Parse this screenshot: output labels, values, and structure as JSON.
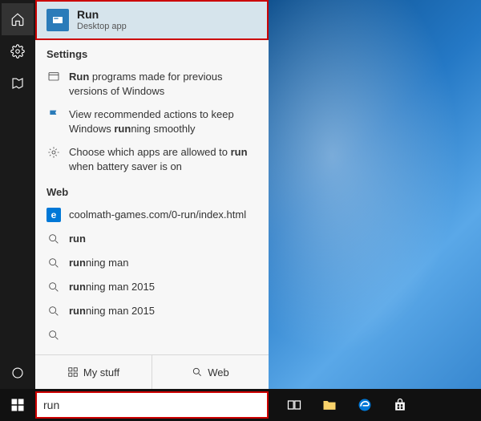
{
  "best_match": {
    "title": "Run",
    "subtitle": "Desktop app"
  },
  "sections": {
    "settings": "Settings",
    "web": "Web"
  },
  "settings_results": [
    {
      "pre": "",
      "bold": "Run",
      "post": " programs made for previous versions of Windows"
    },
    {
      "pre": "View recommended actions to keep Windows ",
      "bold": "run",
      "post": "ning smoothly"
    },
    {
      "pre": "Choose which apps are allowed to ",
      "bold": "run",
      "post": " when battery saver is on"
    }
  ],
  "web_results": [
    {
      "bold": "",
      "text": "coolmath-games.com/0-run/index.html"
    },
    {
      "bold": "run",
      "text": ""
    },
    {
      "bold": "run",
      "text": "ning man"
    },
    {
      "bold": "run",
      "text": "ning man 2015"
    },
    {
      "bold": "run",
      "text": "ning man 2015"
    }
  ],
  "tabs": {
    "mystuff": "My stuff",
    "web": "Web"
  },
  "search_query": "run"
}
